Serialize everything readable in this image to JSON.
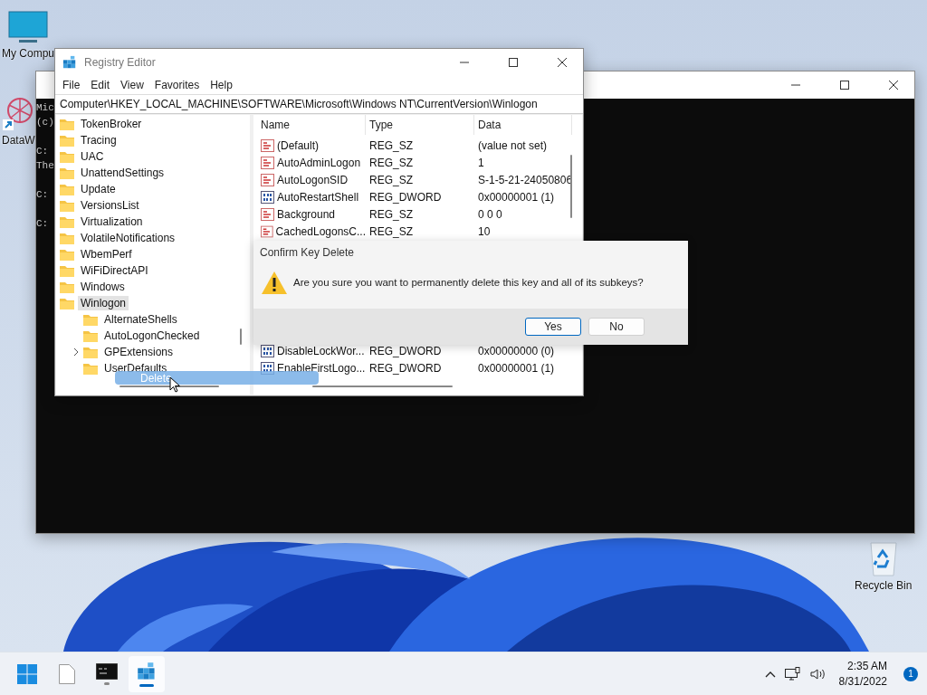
{
  "desktop": {
    "icons": [
      {
        "label": "My Compu",
        "kind": "computer"
      },
      {
        "label": "DataW",
        "kind": "shortcut"
      },
      {
        "label": "Recycle Bin",
        "kind": "recycle"
      }
    ]
  },
  "console": {
    "blocks": [
      [
        "Mic",
        "(c)"
      ],
      [
        "C:",
        "The"
      ],
      [
        "C:"
      ],
      [
        "C:"
      ]
    ]
  },
  "registry": {
    "title": "Registry Editor",
    "menu": [
      "File",
      "Edit",
      "View",
      "Favorites",
      "Help"
    ],
    "address": "Computer\\HKEY_LOCAL_MACHINE\\SOFTWARE\\Microsoft\\Windows NT\\CurrentVersion\\Winlogon",
    "tree": [
      {
        "label": "TokenBroker",
        "selected": false
      },
      {
        "label": "Tracing",
        "selected": false
      },
      {
        "label": "UAC",
        "selected": false
      },
      {
        "label": "UnattendSettings",
        "selected": false
      },
      {
        "label": "Update",
        "selected": false
      },
      {
        "label": "VersionsList",
        "selected": false
      },
      {
        "label": "Virtualization",
        "selected": false
      },
      {
        "label": "VolatileNotifications",
        "selected": false
      },
      {
        "label": "WbemPerf",
        "selected": false
      },
      {
        "label": "WiFiDirectAPI",
        "selected": false
      },
      {
        "label": "Windows",
        "selected": false
      },
      {
        "label": "Winlogon",
        "selected": true,
        "children": [
          {
            "label": "AlternateShells",
            "selected": false,
            "collapsed": false
          },
          {
            "label": "AutoLogonChecked",
            "selected": false,
            "collapsed": false
          },
          {
            "label": "GPExtensions",
            "selected": false,
            "collapsed": true
          },
          {
            "label": "UserDefaults",
            "selected": false,
            "collapsed": false
          }
        ]
      }
    ],
    "columns": [
      "Name",
      "Type",
      "Data"
    ],
    "rows": [
      {
        "kind": "sz",
        "name": "(Default)",
        "type": "REG_SZ",
        "data": "(value not set)"
      },
      {
        "kind": "sz",
        "name": "AutoAdminLogon",
        "type": "REG_SZ",
        "data": "1"
      },
      {
        "kind": "sz",
        "name": "AutoLogonSID",
        "type": "REG_SZ",
        "data": "S-1-5-21-24050806"
      },
      {
        "kind": "dword",
        "name": "AutoRestartShell",
        "type": "REG_DWORD",
        "data": "0x00000001 (1)"
      },
      {
        "kind": "sz",
        "name": "Background",
        "type": "REG_SZ",
        "data": "0 0 0"
      },
      {
        "kind": "sz",
        "name": "CachedLogonsC...",
        "type": "REG_SZ",
        "data": "10"
      },
      {
        "kind": "dword",
        "name": "DisableLockWor...",
        "type": "REG_DWORD",
        "data": "0x00000000 (0)"
      },
      {
        "kind": "dword",
        "name": "EnableFirstLogo...",
        "type": "REG_DWORD",
        "data": "0x00000001 (1)"
      }
    ]
  },
  "context_menu": {
    "items": [
      {
        "label": "Delete",
        "selected": true
      }
    ]
  },
  "dialog": {
    "title": "Confirm Key Delete",
    "message": "Are you sure you want to permanently delete this key and all of its subkeys?",
    "buttons": [
      {
        "label": "Yes",
        "selected": true
      },
      {
        "label": "No",
        "selected": false
      }
    ]
  },
  "taskbar": {
    "apps": [
      {
        "kind": "start",
        "running": false,
        "selected": false
      },
      {
        "kind": "file",
        "running": false,
        "selected": false
      },
      {
        "kind": "terminal",
        "running": true,
        "selected": false
      },
      {
        "kind": "registry",
        "running": true,
        "selected": true
      }
    ],
    "time": "2:35 AM",
    "date": "8/31/2022",
    "badge": "1"
  }
}
